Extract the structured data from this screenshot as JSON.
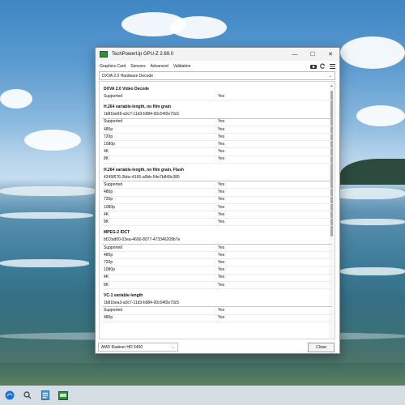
{
  "window": {
    "title": "TechPowerUp GPU-Z 2.69.0",
    "controls": {
      "minimize": "—",
      "maximize": "☐",
      "close": "✕"
    }
  },
  "tabs": [
    {
      "label": "Graphics Card"
    },
    {
      "label": "Sensors"
    },
    {
      "label": "Advanced"
    },
    {
      "label": "Validation"
    }
  ],
  "toolbar_icons": [
    "camera-icon",
    "refresh-icon",
    "menu-icon"
  ],
  "category_select": {
    "value": "DXVA 2.0 Hardware Decode"
  },
  "sections": [
    {
      "title": "DXVA 2.0 Video Decode",
      "guid": "",
      "rows": [
        {
          "label": "Supported",
          "value": "Yes"
        }
      ]
    },
    {
      "title": "H.264 variable-length, no film grain",
      "guid": "1b81be68-a0c7-11d3-b984-00c04f2e73c5",
      "rows": [
        {
          "label": "Supported",
          "value": "Yes"
        },
        {
          "label": "480p",
          "value": "Yes"
        },
        {
          "label": "720p",
          "value": "Yes"
        },
        {
          "label": "1080p",
          "value": "Yes"
        },
        {
          "label": "4K",
          "value": "Yes"
        },
        {
          "label": "8K",
          "value": "Yes"
        }
      ]
    },
    {
      "title": "H.264 variable-length, no film grain, Flash",
      "guid": "4245f676-2bbc-4166-a0bb-54e7b849c380",
      "rows": [
        {
          "label": "Supported",
          "value": "Yes"
        },
        {
          "label": "480p",
          "value": "Yes"
        },
        {
          "label": "720p",
          "value": "Yes"
        },
        {
          "label": "1080p",
          "value": "Yes"
        },
        {
          "label": "4K",
          "value": "Yes"
        },
        {
          "label": "8K",
          "value": "Yes"
        }
      ]
    },
    {
      "title": "MPEG-2 IDCT",
      "guid": "bf22ad00-03ea-4690-8077-473346209b7e",
      "rows": [
        {
          "label": "Supported",
          "value": "Yes"
        },
        {
          "label": "480p",
          "value": "Yes"
        },
        {
          "label": "720p",
          "value": "Yes"
        },
        {
          "label": "1080p",
          "value": "Yes"
        },
        {
          "label": "4K",
          "value": "Yes"
        },
        {
          "label": "8K",
          "value": "Yes"
        }
      ]
    },
    {
      "title": "VC-1 variable-length",
      "guid": "1b81bea3-a0c7-11d3-b984-00c04f2e73c5",
      "rows": [
        {
          "label": "Supported",
          "value": "Yes"
        },
        {
          "label": "480p",
          "value": "Yes"
        }
      ]
    }
  ],
  "gpu_select": {
    "value": "AMD Radeon HD 5450"
  },
  "close_button": {
    "label": "Close"
  },
  "taskbar": {
    "items": [
      "start-icon",
      "search-icon",
      "notepad-icon",
      "gpuz-icon"
    ]
  },
  "colors": {
    "accent": "#2f8f3c",
    "window_bg": "#ffffff"
  }
}
